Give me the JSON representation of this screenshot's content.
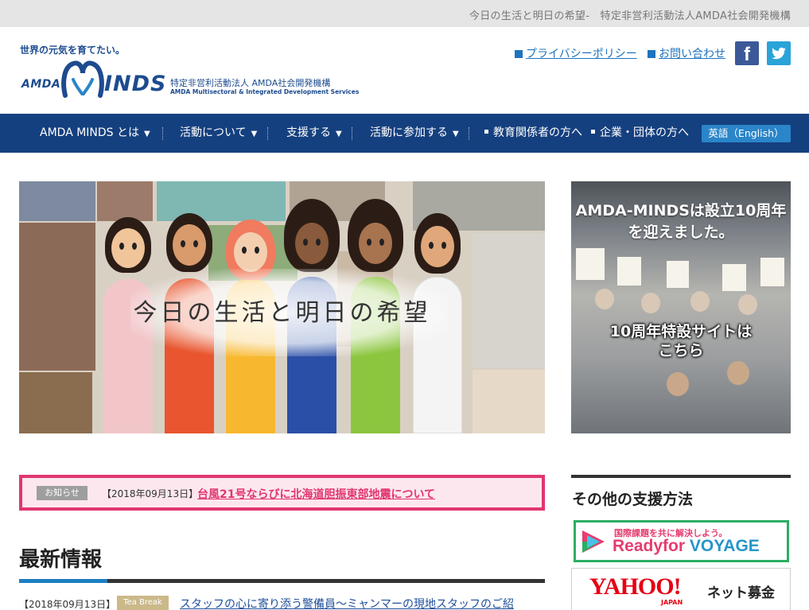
{
  "top_strip": {
    "tagline": "今日の生活と明日の希望-　特定非営利活動法人AMDA社会開発機構"
  },
  "header": {
    "slogan": "世界の元気を育てたい。",
    "logo_left": "AMDA",
    "logo_right": "INDS",
    "org_name_jp": "特定非営利活動法人 AMDA社会開発機構",
    "org_name_en": "AMDA Multisectoral & Integrated Development Services",
    "privacy_link": "プライバシーポリシー",
    "contact_link": "お問い合わせ",
    "facebook_glyph": "f",
    "twitter_icon": "twitter-bird-icon"
  },
  "nav": {
    "items": [
      {
        "label": "AMDA MINDS とは",
        "dropdown": true
      },
      {
        "label": "活動について",
        "dropdown": true
      },
      {
        "label": "支援する",
        "dropdown": true
      },
      {
        "label": "活動に参加する",
        "dropdown": true
      },
      {
        "label": "教育関係者の方へ",
        "dropdown": false
      },
      {
        "label": "企業・団体の方へ",
        "dropdown": false
      }
    ],
    "english_button": "英語（English）",
    "caret": "▼"
  },
  "hero": {
    "title": "今日の生活と明日の希望"
  },
  "anniversary": {
    "headline_line1": "AMDA-MINDSは設立10周年",
    "headline_line2": "を迎えました。",
    "cta_line1": "10周年特設サイトは",
    "cta_line2": "こちら"
  },
  "notice": {
    "badge": "お知らせ",
    "date": "【2018年09月13日】",
    "link": "台風21号ならびに北海道胆振東部地震について"
  },
  "latest": {
    "title": "最新情報",
    "items": [
      {
        "date": "【2018年09月13日】",
        "tag": "Tea Break",
        "title": "スタッフの心に寄り添う警備員〜ミャンマーの現地スタッフのご紹"
      }
    ]
  },
  "sidebar": {
    "title": "その他の支援方法",
    "ready_top": "国際課題を共に解決しよう。",
    "ready_main_1": "Readyfor ",
    "ready_main_2": "VOYAGE",
    "yahoo_logo": "YAHOO!",
    "yahoo_japan": "JAPAN",
    "yahoo_service": "ネット募金"
  },
  "colors": {
    "nav_bg": "#15407f",
    "brand_blue": "#1d4b8f",
    "link_blue": "#1e73be",
    "notice_pink": "#e13670",
    "accent_blue": "#1b7fc1",
    "tag_beige": "#cbb98a"
  }
}
